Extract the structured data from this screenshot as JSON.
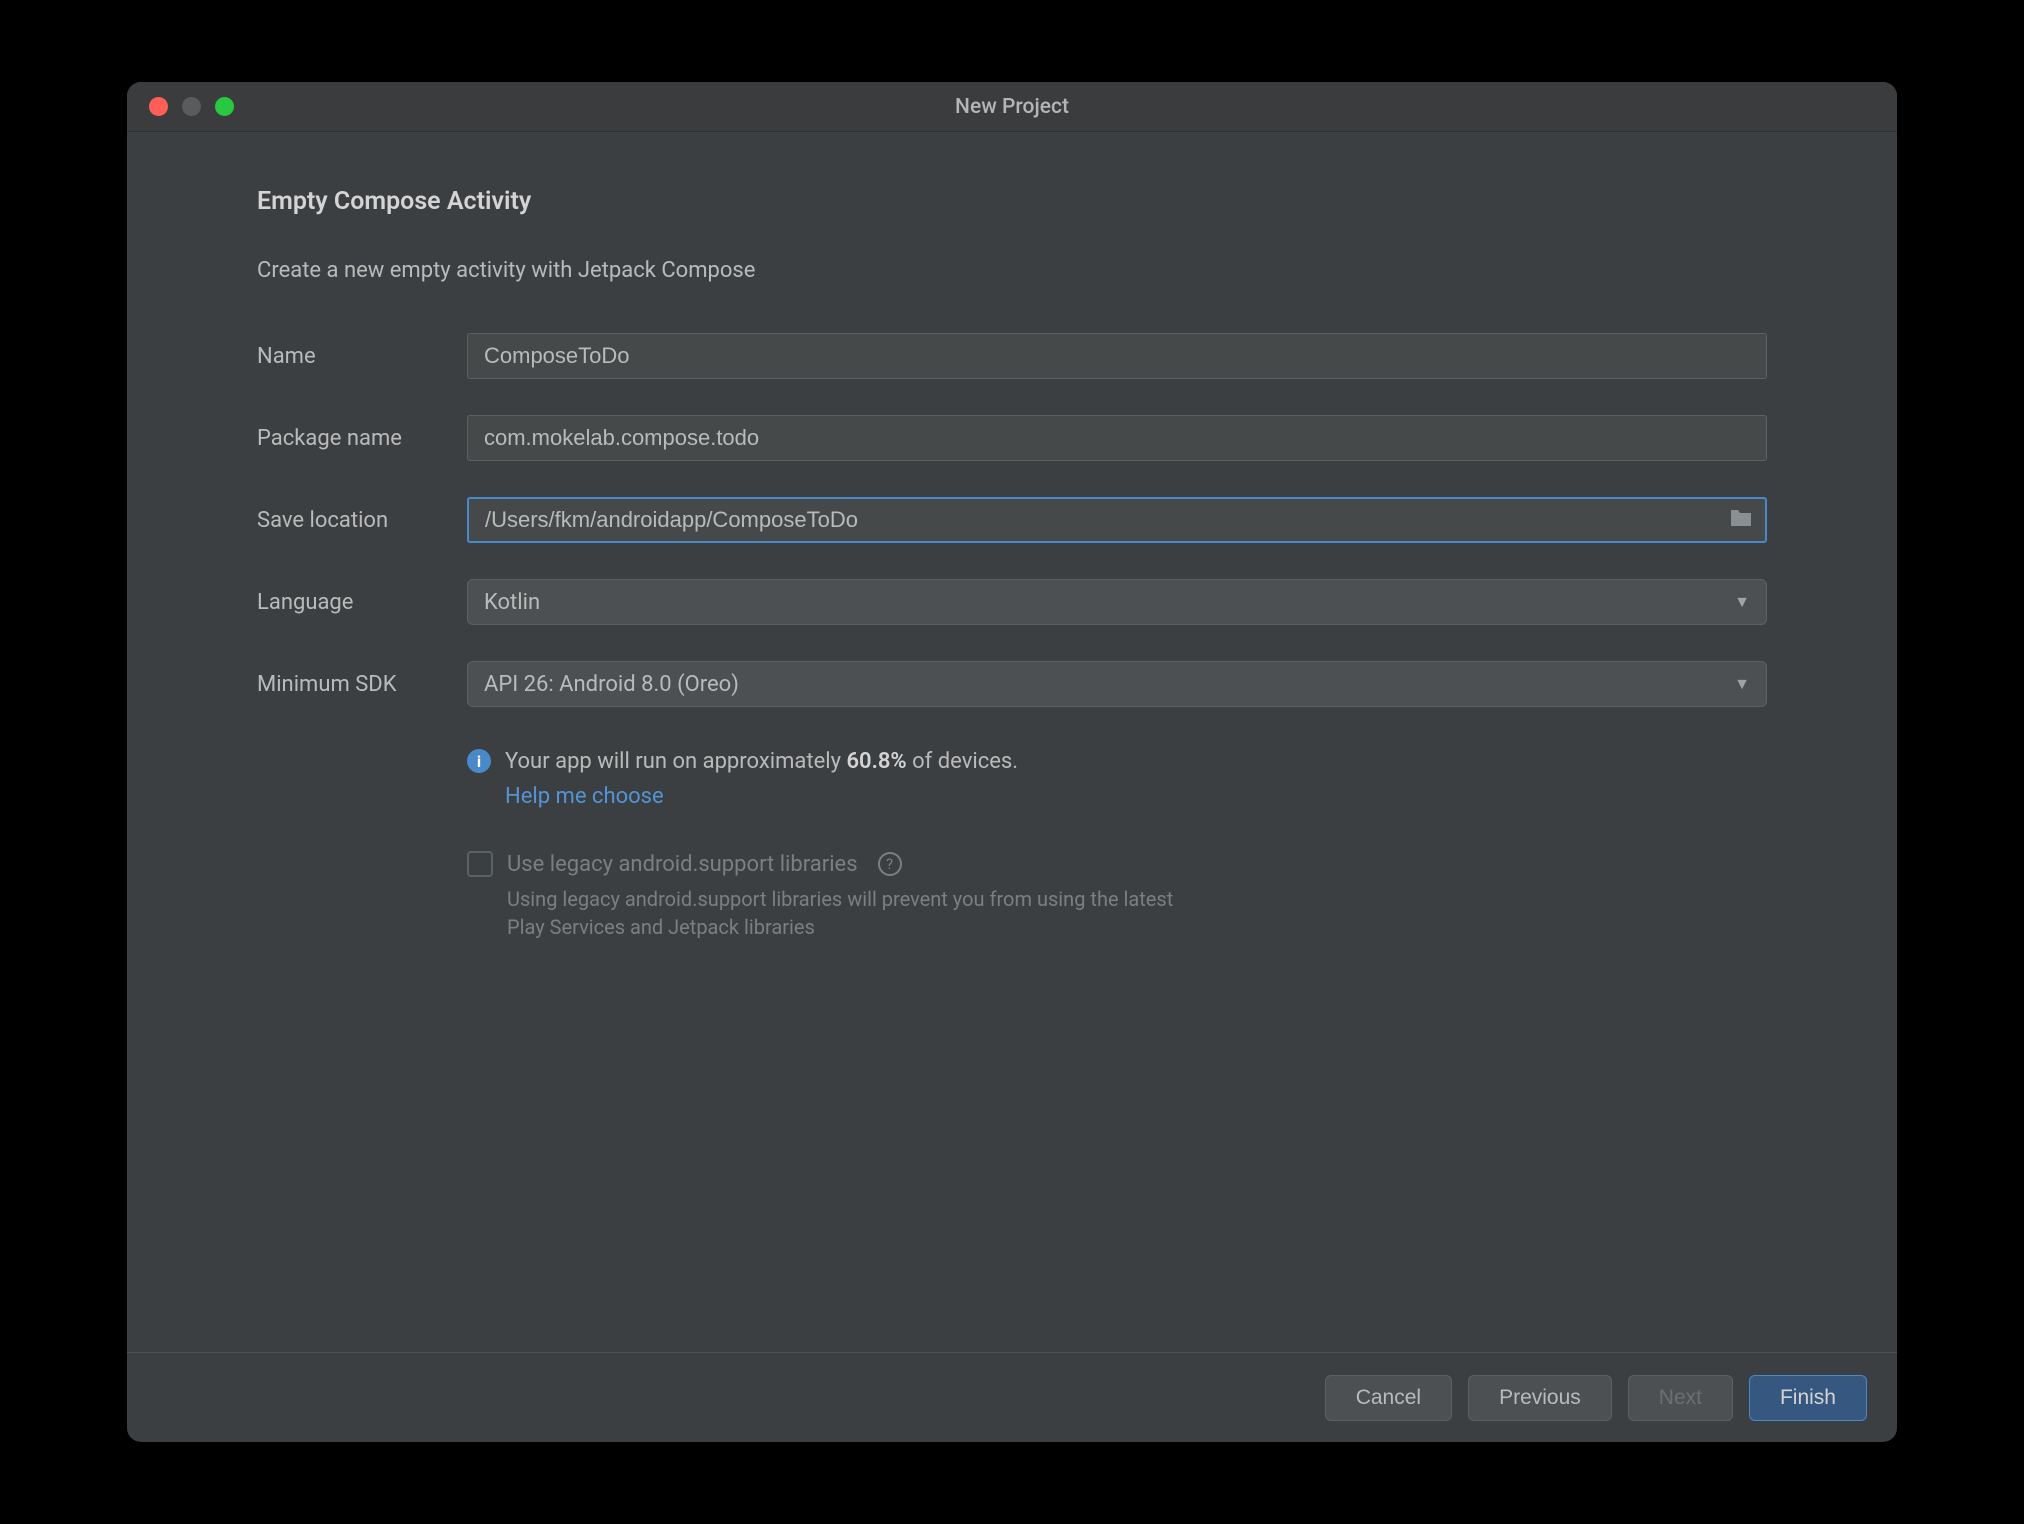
{
  "window": {
    "title": "New Project"
  },
  "header": {
    "heading": "Empty Compose Activity",
    "subtitle": "Create a new empty activity with Jetpack Compose"
  },
  "form": {
    "name": {
      "label": "Name",
      "value": "ComposeToDo"
    },
    "packageName": {
      "label": "Package name",
      "value": "com.mokelab.compose.todo"
    },
    "saveLocation": {
      "label": "Save location",
      "value": "/Users/fkm/androidapp/ComposeToDo"
    },
    "language": {
      "label": "Language",
      "value": "Kotlin"
    },
    "minimumSdk": {
      "label": "Minimum SDK",
      "value": "API 26: Android 8.0 (Oreo)"
    }
  },
  "info": {
    "prefix": "Your app will run on approximately ",
    "percent": "60.8%",
    "suffix": " of devices.",
    "helpLink": "Help me choose"
  },
  "legacy": {
    "label": "Use legacy android.support libraries",
    "description": "Using legacy android.support libraries will prevent you from using the latest Play Services and Jetpack libraries"
  },
  "buttons": {
    "cancel": "Cancel",
    "previous": "Previous",
    "next": "Next",
    "finish": "Finish"
  }
}
